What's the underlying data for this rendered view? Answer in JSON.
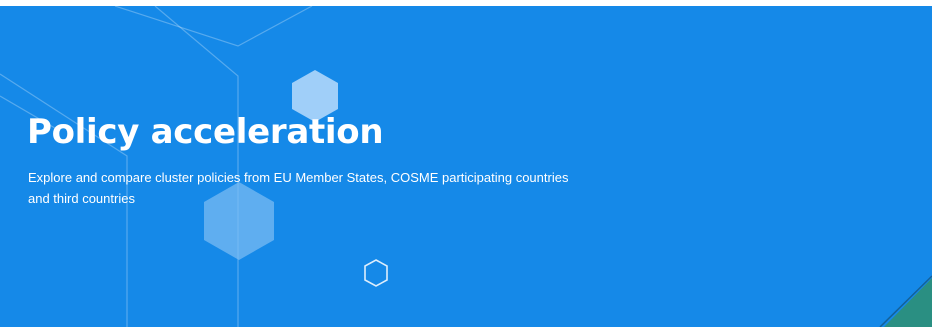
{
  "hero": {
    "title": "Policy acceleration",
    "subtitle": "Explore and compare cluster policies from EU Member States, COSME participating countries and third countries"
  },
  "colors": {
    "hero_background": "#1589e8",
    "corner_accent": "#2a8f82"
  }
}
